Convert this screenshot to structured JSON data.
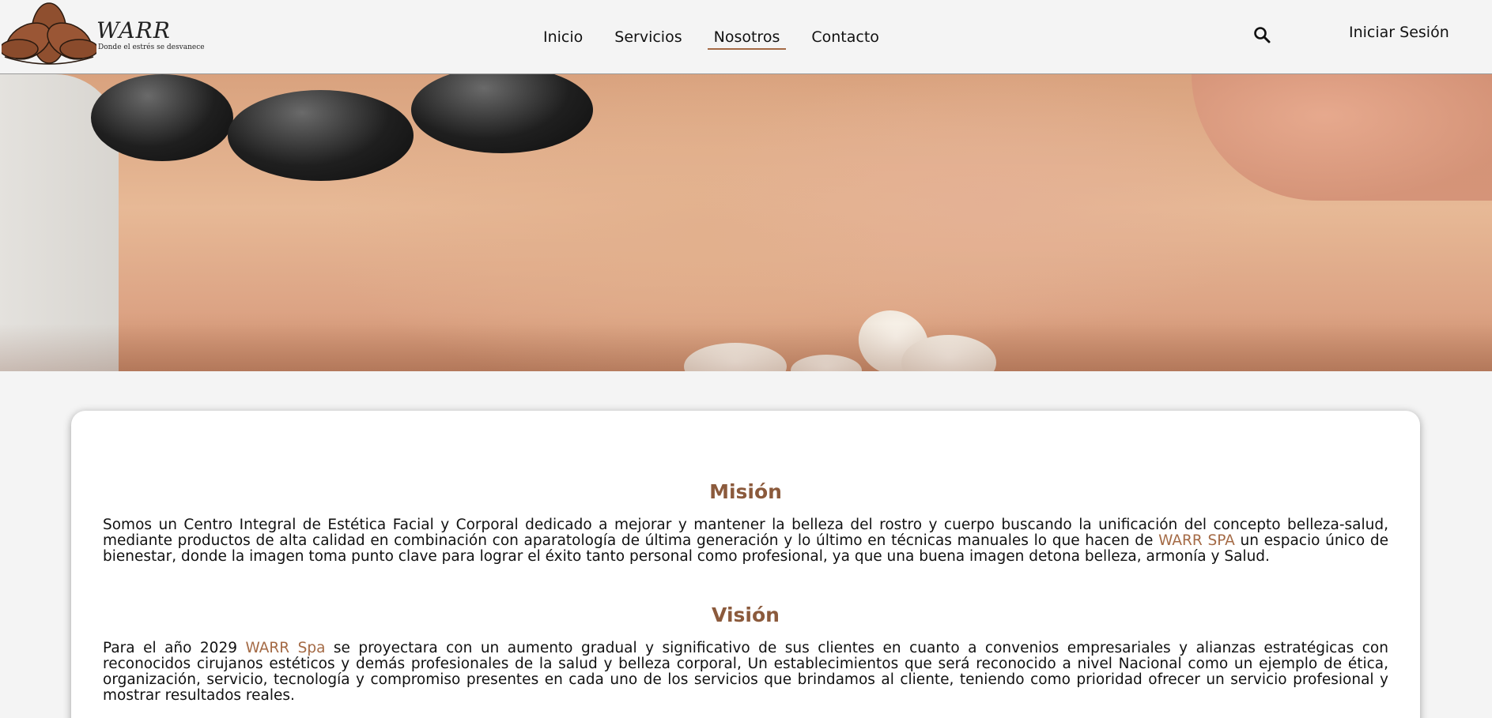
{
  "header": {
    "logo_title": "WARR",
    "logo_tagline": "Donde el estrés se desvanece",
    "nav": [
      {
        "label": "Inicio",
        "active": false
      },
      {
        "label": "Servicios",
        "active": false
      },
      {
        "label": "Nosotros",
        "active": true
      },
      {
        "label": "Contacto",
        "active": false
      }
    ],
    "search_icon": "search-icon",
    "login_label": "Iniciar Sesión"
  },
  "colors": {
    "accent": "#a46a45",
    "title": "#8b5a3c",
    "logo_petal": "#8f4f2f",
    "background": "#f4f4f4"
  },
  "about": {
    "mision": {
      "title": "Misión",
      "text_before": "Somos un Centro Integral de Estética Facial y Corporal dedicado a mejorar y mantener la belleza del rostro y cuerpo buscando la unificación del concepto belleza-salud, mediante productos de alta calidad en combinación con aparatología de última generación y lo último en técnicas manuales lo que hacen de ",
      "brand": "WARR SPA",
      "text_after": " un espacio único de bienestar, donde la imagen toma punto clave para lograr el éxito tanto personal como profesional, ya que una buena imagen detona belleza, armonía y Salud."
    },
    "vision": {
      "title": "Visión",
      "text_before": "Para el año 2029 ",
      "brand": "WARR Spa",
      "text_after": " se proyectara con un aumento gradual y significativo de sus clientes en cuanto a convenios empresariales y alianzas estratégicas con reconocidos cirujanos estéticos y demás profesionales de la salud y belleza corporal, Un establecimientos que será reconocido a nivel Nacional como un ejemplo de ética, organización, servicio, tecnología y compromiso presentes en cada uno de los servicios que brindamos al cliente, teniendo como prioridad ofrecer un servicio profesional y mostrar resultados reales."
    }
  }
}
